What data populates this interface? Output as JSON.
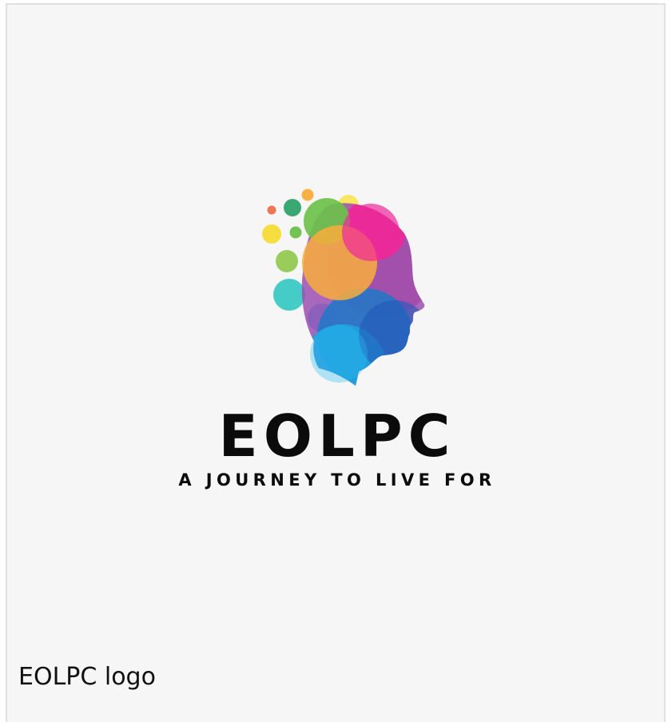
{
  "logo": {
    "brand_name": "EOLPC",
    "tagline": "A JOURNEY TO LIVE FOR"
  },
  "caption": "EOLPC logo",
  "colors": {
    "background": "#f6f6f6",
    "border": "#e0e0e0",
    "text": "#0b0b0b",
    "pink": "#ec2a9a",
    "purple": "#8e3fa6",
    "orange": "#f9ad3c",
    "green": "#6cc04a",
    "dark_green": "#2ea36b",
    "yellow": "#f7e552",
    "teal": "#3cc9c4",
    "light_blue": "#2cbcf0",
    "blue": "#1f78c7"
  }
}
